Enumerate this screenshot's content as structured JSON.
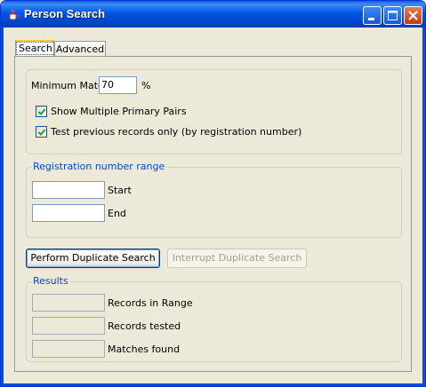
{
  "window": {
    "title": "Person Search",
    "controls": [
      "minimize-icon",
      "maximize-icon",
      "close-icon"
    ]
  },
  "tabs": [
    {
      "label": "Search",
      "selected": true
    },
    {
      "label": "Advanced",
      "selected": false
    }
  ],
  "options": {
    "min_match_label": "Minimum Match",
    "min_match_value": "70",
    "min_match_unit": "%",
    "show_multiple_label": "Show Multiple Primary Pairs",
    "show_multiple_checked": true,
    "test_previous_label": "Test previous records only (by registration number)",
    "test_previous_checked": true
  },
  "registration": {
    "title": "Registration number range",
    "start_label": "Start",
    "start_value": "",
    "end_label": "End",
    "end_value": ""
  },
  "actions": {
    "perform_label": "Perform Duplicate Search",
    "interrupt_label": "Interrupt Duplicate Search"
  },
  "results": {
    "title": "Results",
    "records_in_range_label": "Records in Range",
    "records_in_range_value": "",
    "records_tested_label": "Records tested",
    "records_tested_value": "",
    "matches_found_label": "Matches found",
    "matches_found_value": ""
  },
  "colors": {
    "titlebar": "#0055e5",
    "group_title": "#0046d5",
    "background": "#ece9d8"
  }
}
